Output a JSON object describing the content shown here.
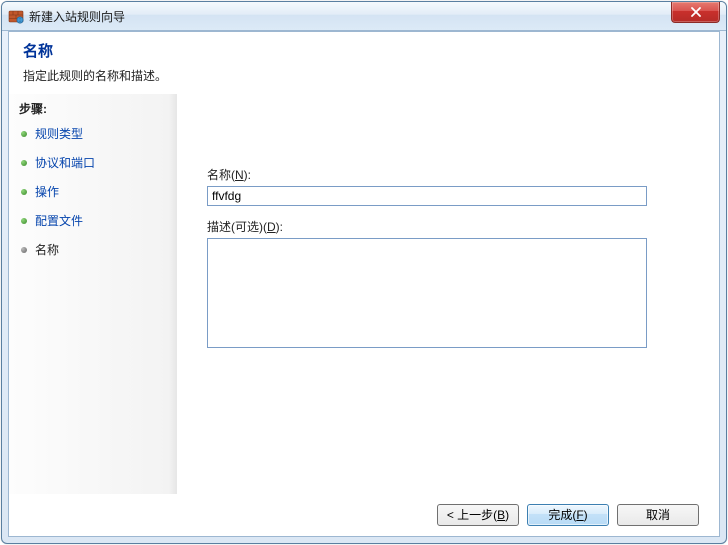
{
  "window": {
    "title": "新建入站规则向导"
  },
  "header": {
    "title": "名称",
    "subtitle": "指定此规则的名称和描述。"
  },
  "sidebar": {
    "stepsTitle": "步骤:",
    "steps": [
      {
        "label": "规则类型"
      },
      {
        "label": "协议和端口"
      },
      {
        "label": "操作"
      },
      {
        "label": "配置文件"
      },
      {
        "label": "名称"
      }
    ]
  },
  "form": {
    "name": {
      "labelPrefix": "名称(",
      "mnemonic": "N",
      "labelSuffix": "):",
      "value": "ffvfdg"
    },
    "description": {
      "labelPrefix": "描述(可选)(",
      "mnemonic": "D",
      "labelSuffix": "):",
      "value": ""
    }
  },
  "buttons": {
    "back": {
      "prefix": "< 上一步(",
      "mn": "B",
      "suffix": ")"
    },
    "finish": {
      "prefix": "完成(",
      "mn": "F",
      "suffix": ")"
    },
    "cancel": {
      "label": "取消"
    }
  }
}
